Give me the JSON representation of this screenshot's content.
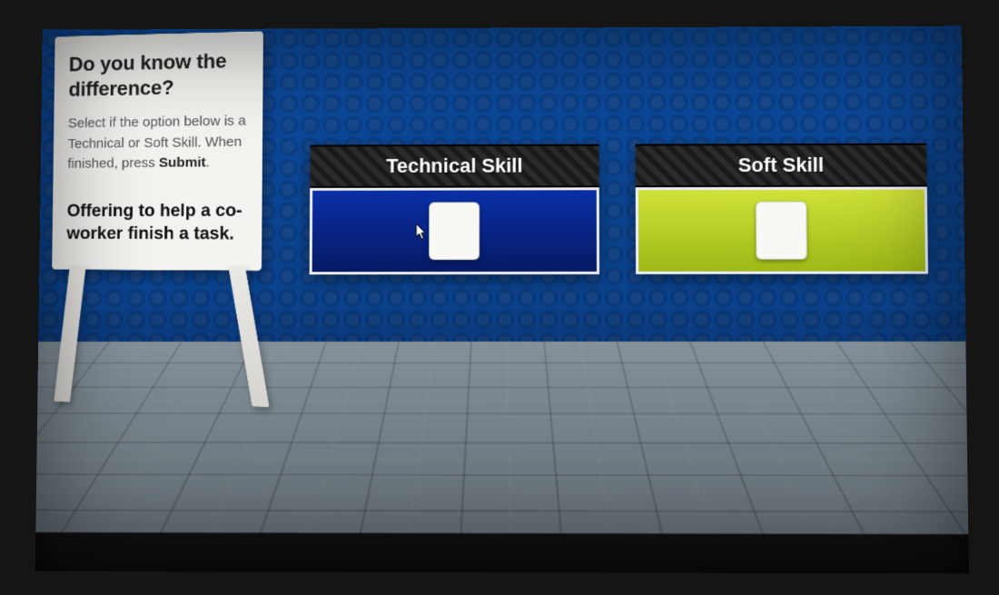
{
  "sign": {
    "heading": "Do you know the difference?",
    "instruction_pre": "Select if the option below is a Technical or Soft Skill. When finished, press ",
    "instruction_bold": "Submit",
    "instruction_post": ".",
    "prompt": "Offering to help a co-worker finish a task."
  },
  "answers": {
    "technical_label": "Technical Skill",
    "soft_label": "Soft Skill"
  }
}
